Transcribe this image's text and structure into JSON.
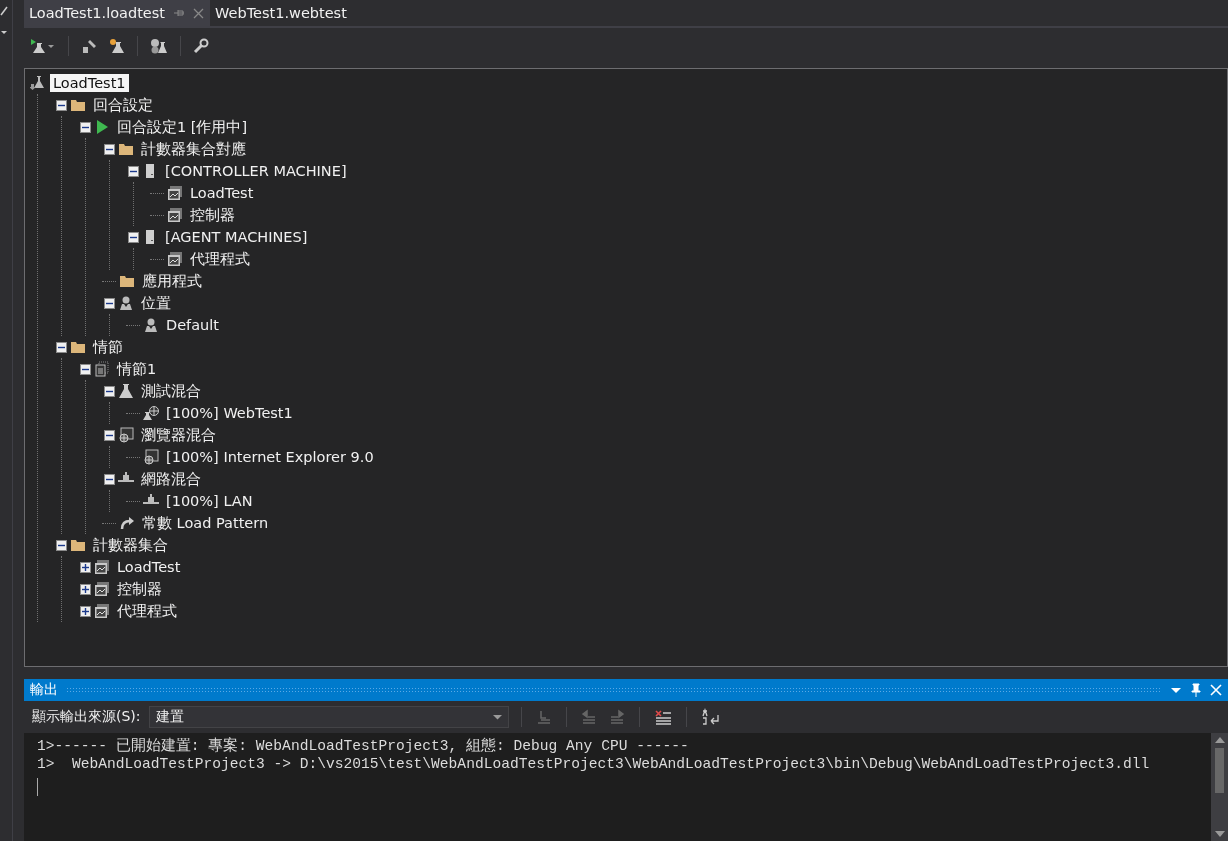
{
  "tabs": [
    {
      "label": "LoadTest1.loadtest",
      "selected": true
    },
    {
      "label": "WebTest1.webtest",
      "selected": false
    }
  ],
  "tree": {
    "label": "LoadTest1",
    "kind": "loadtest",
    "selected": true,
    "children": [
      {
        "label": "回合設定",
        "kind": "folder",
        "expanded": true,
        "children": [
          {
            "label": "回合設定1 [作用中]",
            "kind": "run",
            "expanded": true,
            "children": [
              {
                "label": "計數器集合對應",
                "kind": "folder",
                "expanded": true,
                "children": [
                  {
                    "label": "[CONTROLLER MACHINE]",
                    "kind": "server",
                    "expanded": true,
                    "children": [
                      {
                        "label": "LoadTest",
                        "kind": "counter"
                      },
                      {
                        "label": "控制器",
                        "kind": "counter"
                      }
                    ]
                  },
                  {
                    "label": "[AGENT MACHINES]",
                    "kind": "server",
                    "expanded": true,
                    "children": [
                      {
                        "label": "代理程式",
                        "kind": "counter"
                      }
                    ]
                  }
                ]
              },
              {
                "label": "應用程式",
                "kind": "folder"
              },
              {
                "label": "位置",
                "kind": "location",
                "expanded": true,
                "children": [
                  {
                    "label": "Default",
                    "kind": "location"
                  }
                ]
              }
            ]
          }
        ]
      },
      {
        "label": "情節",
        "kind": "folder",
        "expanded": true,
        "children": [
          {
            "label": "情節1",
            "kind": "scenario",
            "expanded": true,
            "children": [
              {
                "label": "測試混合",
                "kind": "flask",
                "expanded": true,
                "children": [
                  {
                    "label": "[100%] WebTest1",
                    "kind": "webtest"
                  }
                ]
              },
              {
                "label": "瀏覽器混合",
                "kind": "browser",
                "expanded": true,
                "children": [
                  {
                    "label": "[100%] Internet Explorer 9.0",
                    "kind": "browser"
                  }
                ]
              },
              {
                "label": "網路混合",
                "kind": "network",
                "expanded": true,
                "children": [
                  {
                    "label": "[100%] LAN",
                    "kind": "network"
                  }
                ]
              },
              {
                "label": "常數 Load Pattern",
                "kind": "pattern"
              }
            ]
          }
        ]
      },
      {
        "label": "計數器集合",
        "kind": "folder",
        "expanded": true,
        "children": [
          {
            "label": "LoadTest",
            "kind": "counter",
            "expanded": false
          },
          {
            "label": "控制器",
            "kind": "counter",
            "expanded": false
          },
          {
            "label": "代理程式",
            "kind": "counter",
            "expanded": false
          }
        ]
      }
    ]
  },
  "output": {
    "title": "輸出",
    "source_label": "顯示輸出來源(S):",
    "source_value": "建置",
    "lines": [
      "1>------ 已開始建置: 專案: WebAndLoadTestProject3, 組態: Debug Any CPU ------",
      "1>  WebAndLoadTestProject3 -> D:\\vs2015\\test\\WebAndLoadTestProject3\\WebAndLoadTestProject3\\bin\\Debug\\WebAndLoadTestProject3.dll"
    ]
  }
}
